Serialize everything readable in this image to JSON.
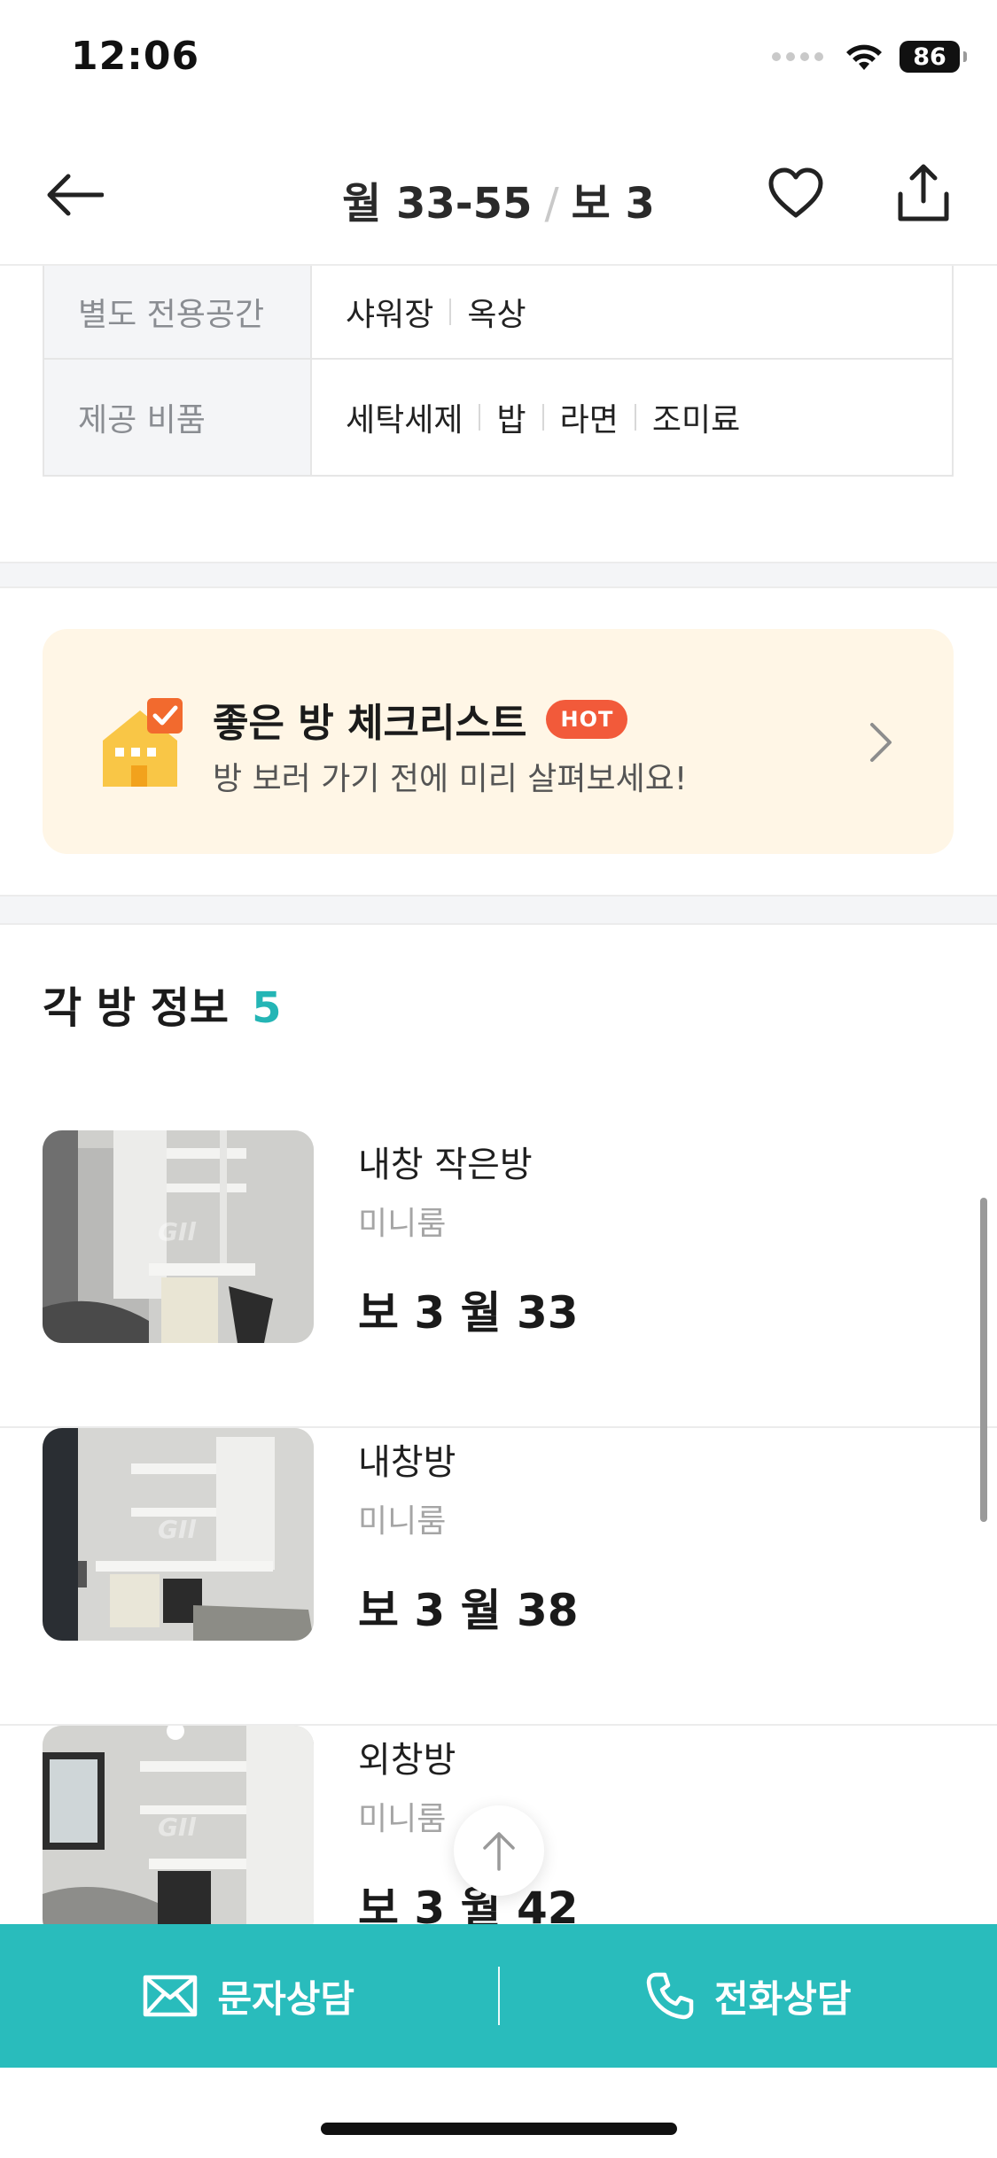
{
  "status_bar": {
    "time": "12:06",
    "battery": "86"
  },
  "header": {
    "monthly": "월 33-55",
    "separator": "/",
    "deposit": "보 3"
  },
  "info_table": {
    "rows": [
      {
        "label": "별도 전용공간",
        "values": [
          "샤워장",
          "옥상"
        ]
      },
      {
        "label": "제공 비품",
        "values": [
          "세탁세제",
          "밥",
          "라면",
          "조미료"
        ]
      }
    ]
  },
  "checklist": {
    "title": "좋은 방 체크리스트",
    "badge": "HOT",
    "subtitle": "방 보러 가기 전에 미리 살펴보세요!"
  },
  "rooms": {
    "title": "각 방 정보",
    "count": "5",
    "watermark": "GIl",
    "items": [
      {
        "name": "내창 작은방",
        "type": "미니룸",
        "price": "보 3 월 33"
      },
      {
        "name": "내창방",
        "type": "미니룸",
        "price": "보 3 월 38"
      },
      {
        "name": "외창방",
        "type": "미니룸",
        "price": "보 3 월 42"
      }
    ]
  },
  "bottom_bar": {
    "sms_label": "문자상담",
    "call_label": "전화상담"
  },
  "colors": {
    "accent": "#29bcbc",
    "count": "#24b5b5",
    "hot": "#f25a3a",
    "banner_bg": "#fff6e6",
    "house": "#f9c646",
    "check": "#f26a2e"
  }
}
